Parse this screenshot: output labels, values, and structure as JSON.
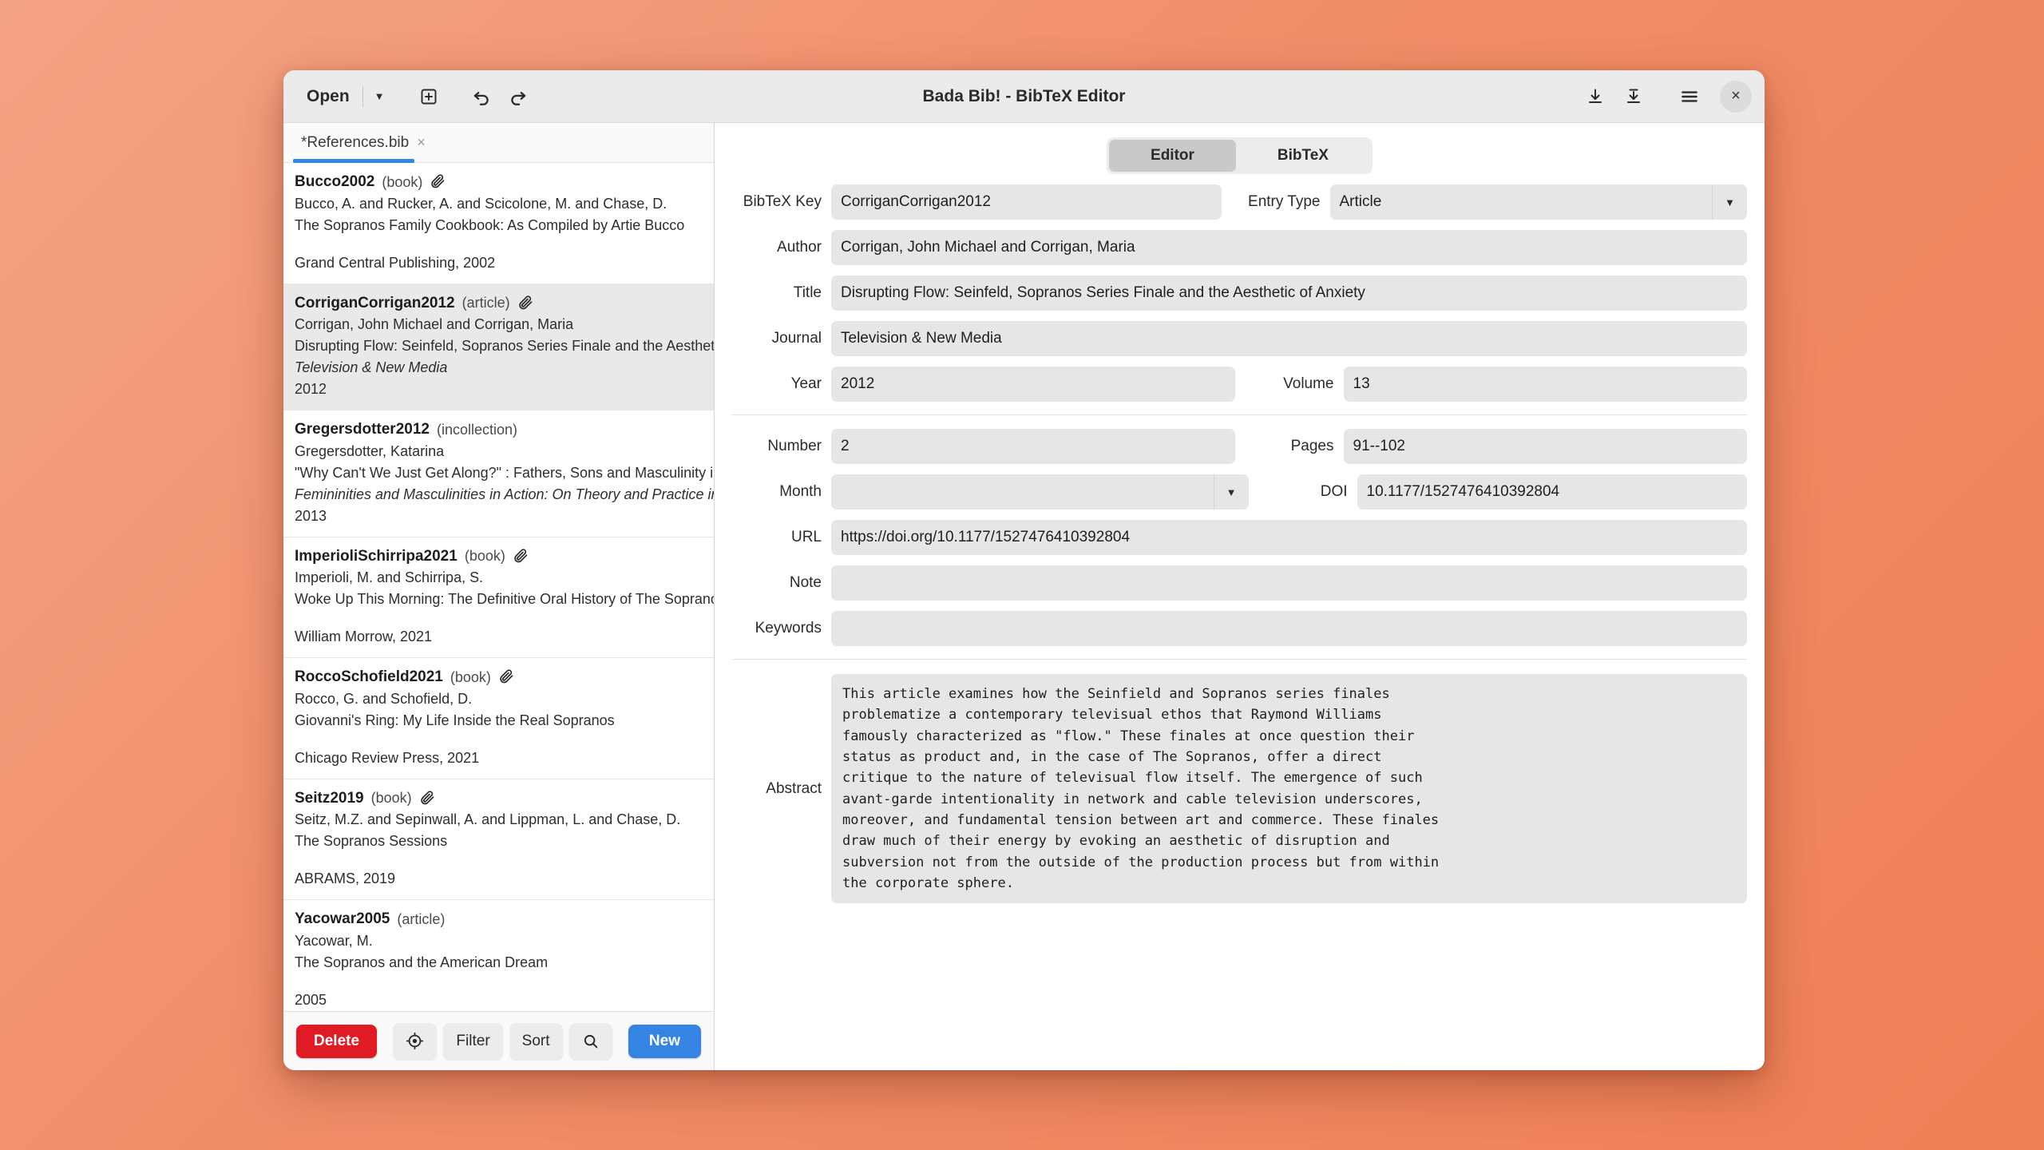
{
  "window": {
    "title": "Bada Bib! - BibTeX Editor",
    "open_label": "Open",
    "icons": {
      "open_dropdown": "chevron-down-icon",
      "new_tab": "add-tab-icon",
      "undo": "undo-icon",
      "redo": "redo-icon",
      "save": "save-icon",
      "save_as": "save-as-icon",
      "menu": "hamburger-menu-icon",
      "close": "close-icon"
    },
    "close_glyph": "×"
  },
  "file_tabs": [
    {
      "label": "*References.bib",
      "close_glyph": "×",
      "active": true
    }
  ],
  "entries": [
    {
      "key": "Bucco2002",
      "type": "(book)",
      "has_attachment": true,
      "authors": "Bucco, A. and Rucker, A. and Scicolone, M. and Chase, D.",
      "title": "The Sopranos Family Cookbook: As Compiled by Artie Bucco",
      "container": "",
      "footer": "Grand Central Publishing, 2002",
      "selected": false
    },
    {
      "key": "CorriganCorrigan2012",
      "type": "(article)",
      "has_attachment": true,
      "authors": "Corrigan, John Michael and Corrigan, Maria",
      "title": "Disrupting Flow: Seinfeld, Sopranos Series Finale and the Aesthetic of Anxiety",
      "container": "Television & New Media",
      "footer": "2012",
      "selected": true
    },
    {
      "key": "Gregersdotter2012",
      "type": "(incollection)",
      "has_attachment": false,
      "authors": "Gregersdotter, Katarina",
      "title": "\"Why Can't We Just Get Along?\" : Fathers, Sons and Masculinity in The Sopranos",
      "container": "Femininities and Masculinities in Action: On Theory and Practice in a Moving Field",
      "footer": "2013",
      "selected": false
    },
    {
      "key": "ImperioliSchirripa2021",
      "type": "(book)",
      "has_attachment": true,
      "authors": "Imperioli, M. and Schirripa, S.",
      "title": "Woke Up This Morning: The Definitive Oral History of The Sopranos",
      "container": "",
      "footer": "William Morrow, 2021",
      "selected": false
    },
    {
      "key": "RoccoSchofield2021",
      "type": "(book)",
      "has_attachment": true,
      "authors": "Rocco, G. and Schofield, D.",
      "title": "Giovanni's Ring: My Life Inside the Real Sopranos",
      "container": "",
      "footer": "Chicago Review Press, 2021",
      "selected": false
    },
    {
      "key": "Seitz2019",
      "type": "(book)",
      "has_attachment": true,
      "authors": "Seitz, M.Z. and Sepinwall, A. and Lippman, L. and Chase, D.",
      "title": "The Sopranos Sessions",
      "container": "",
      "footer": "ABRAMS, 2019",
      "selected": false
    },
    {
      "key": "Yacowar2005",
      "type": "(article)",
      "has_attachment": false,
      "authors": "Yacowar, M.",
      "title": "The Sopranos and the American Dream",
      "container": "",
      "footer": "2005",
      "selected": false
    }
  ],
  "action_bar": {
    "delete_label": "Delete",
    "locate_icon": "target-icon",
    "filter_label": "Filter",
    "sort_label": "Sort",
    "search_icon": "search-icon",
    "new_label": "New"
  },
  "editor": {
    "tabs": [
      {
        "label": "Editor",
        "active": true
      },
      {
        "label": "BibTeX",
        "active": false
      }
    ],
    "labels": {
      "bibtex_key": "BibTeX Key",
      "entry_type": "Entry Type",
      "author": "Author",
      "title": "Title",
      "journal": "Journal",
      "year": "Year",
      "volume": "Volume",
      "number": "Number",
      "pages": "Pages",
      "month": "Month",
      "doi": "DOI",
      "url": "URL",
      "note": "Note",
      "keywords": "Keywords",
      "abstract": "Abstract"
    },
    "values": {
      "bibtex_key": "CorriganCorrigan2012",
      "entry_type": "Article",
      "author": "Corrigan, John Michael and Corrigan, Maria",
      "title": "Disrupting Flow: Seinfeld, Sopranos Series Finale and the Aesthetic of Anxiety",
      "journal": "Television & New Media",
      "year": "2012",
      "volume": "13",
      "number": "2",
      "pages": "91--102",
      "month": "",
      "doi": "10.1177/1527476410392804",
      "url": "https://doi.org/10.1177/1527476410392804",
      "note": "",
      "keywords": "",
      "abstract": "This article examines how the Seinfield and Sopranos series finales\nproblematize a contemporary televisual ethos that Raymond Williams\nfamously characterized as \"flow.\" These finales at once question their\nstatus as product and, in the case of The Sopranos, offer a direct\ncritique to the nature of televisual flow itself. The emergence of such\navant-garde intentionality in network and cable television underscores,\nmoreover, and fundamental tension between art and commerce. These finales\ndraw much of their energy by evoking an aesthetic of disruption and\nsubversion not from the outside of the production process but from within\nthe corporate sphere."
    }
  },
  "colors": {
    "accent_blue": "#3584e4",
    "danger_red": "#e01b24",
    "field_bg": "#e6e6e6",
    "selected_row": "#e9e9e9"
  }
}
